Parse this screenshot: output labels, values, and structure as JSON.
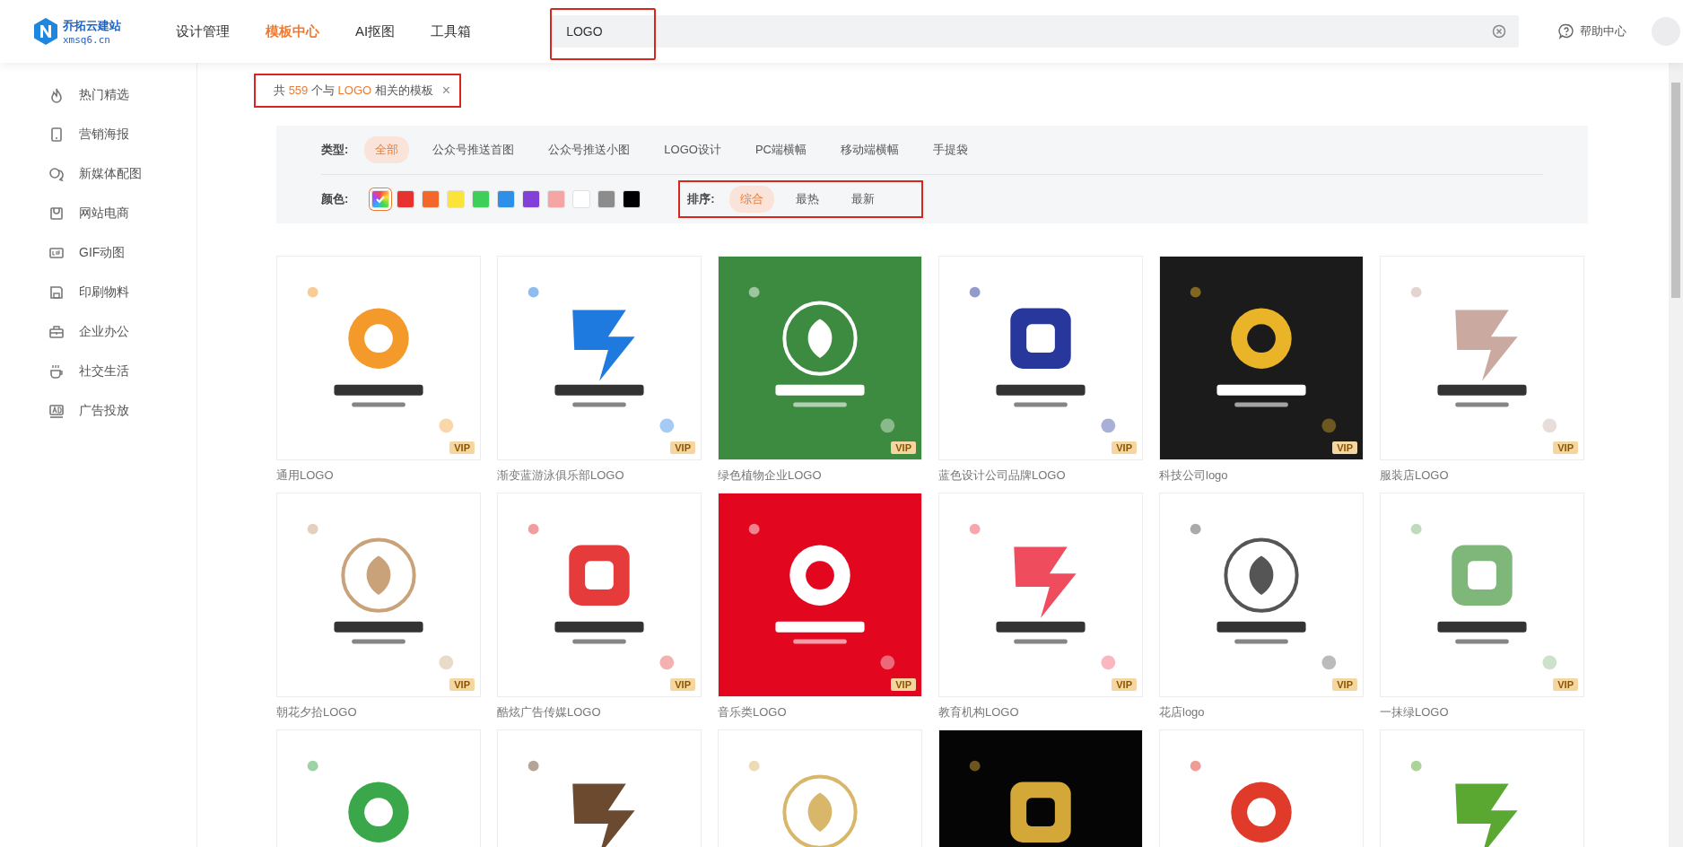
{
  "brand": {
    "name": "乔拓云建站",
    "domain": "xmsq6.cn"
  },
  "nav": [
    {
      "label": "设计管理",
      "selected": false
    },
    {
      "label": "模板中心",
      "selected": true
    },
    {
      "label": "AI抠图",
      "selected": false
    },
    {
      "label": "工具箱",
      "selected": false
    }
  ],
  "search": {
    "value": "LOGO",
    "highlighted": true
  },
  "help": {
    "label": "帮助中心"
  },
  "sidebar": {
    "items": [
      {
        "label": "热门精选"
      },
      {
        "label": "营销海报"
      },
      {
        "label": "新媒体配图"
      },
      {
        "label": "网站电商"
      },
      {
        "label": "GIF动图"
      },
      {
        "label": "印刷物料"
      },
      {
        "label": "企业办公"
      },
      {
        "label": "社交生活"
      },
      {
        "label": "广告投放"
      }
    ]
  },
  "result_summary": {
    "prefix": "共",
    "count": "559",
    "middle": "个与",
    "keyword": "LOGO",
    "suffix": "相关的模板",
    "close": "×",
    "highlighted": true
  },
  "filters": {
    "type_label": "类型:",
    "types": [
      {
        "label": "全部",
        "selected": true
      },
      {
        "label": "公众号推送首图",
        "selected": false
      },
      {
        "label": "公众号推送小图",
        "selected": false
      },
      {
        "label": "LOGO设计",
        "selected": false
      },
      {
        "label": "PC端横幅",
        "selected": false
      },
      {
        "label": "移动端横幅",
        "selected": false
      },
      {
        "label": "手提袋",
        "selected": false
      }
    ],
    "color_label": "颜色:",
    "colors": [
      {
        "kind": "all",
        "selected": true
      },
      {
        "kind": "solid",
        "color": "#e8322f",
        "selected": false
      },
      {
        "kind": "solid",
        "color": "#f2672a",
        "selected": false
      },
      {
        "kind": "solid",
        "color": "#fbe33a",
        "selected": false
      },
      {
        "kind": "solid",
        "color": "#3ecf5a",
        "selected": false
      },
      {
        "kind": "solid",
        "color": "#2d8fe8",
        "selected": false
      },
      {
        "kind": "solid",
        "color": "#8240d8",
        "selected": false
      },
      {
        "kind": "solid",
        "color": "#f6a5a5",
        "selected": false
      },
      {
        "kind": "solid",
        "color": "#ffffff",
        "selected": false
      },
      {
        "kind": "solid",
        "color": "#8c8c8c",
        "selected": false
      },
      {
        "kind": "solid",
        "color": "#000000",
        "selected": false
      }
    ],
    "sort": {
      "label": "排序:",
      "highlighted": true,
      "options": [
        {
          "label": "综合",
          "selected": true
        },
        {
          "label": "最热",
          "selected": false
        },
        {
          "label": "最新",
          "selected": false
        }
      ]
    }
  },
  "templates": [
    {
      "kind": "picture",
      "badge": "VIP",
      "title": "通用LOGO"
    },
    {
      "kind": "picture",
      "badge": "VIP",
      "title": "渐变蓝游泳俱乐部LOGO"
    },
    {
      "kind": "picture",
      "badge": "VIP",
      "title": "绿色植物企业LOGO"
    },
    {
      "kind": "picture",
      "badge": "VIP",
      "title": "蓝色设计公司品牌LOGO"
    },
    {
      "kind": "picture",
      "badge": "VIP",
      "title": "科技公司logo"
    },
    {
      "kind": "picture",
      "badge": "VIP",
      "title": "服装店LOGO"
    },
    {
      "kind": "picture",
      "badge": "VIP",
      "title": "朝花夕拾LOGO"
    },
    {
      "kind": "picture",
      "badge": "VIP",
      "title": "酷炫广告传媒LOGO"
    },
    {
      "kind": "picture",
      "badge": "VIP",
      "title": "音乐类LOGO"
    },
    {
      "kind": "picture",
      "badge": "VIP",
      "title": "教育机构LOGO"
    },
    {
      "kind": "picture",
      "badge": "VIP",
      "title": "花店logo"
    },
    {
      "kind": "picture",
      "badge": "VIP",
      "title": "一抹绿LOGO"
    },
    {
      "kind": "picture"
    },
    {
      "kind": "picture"
    },
    {
      "kind": "picture"
    },
    {
      "kind": "picture"
    },
    {
      "kind": "picture"
    },
    {
      "kind": "picture"
    }
  ]
}
